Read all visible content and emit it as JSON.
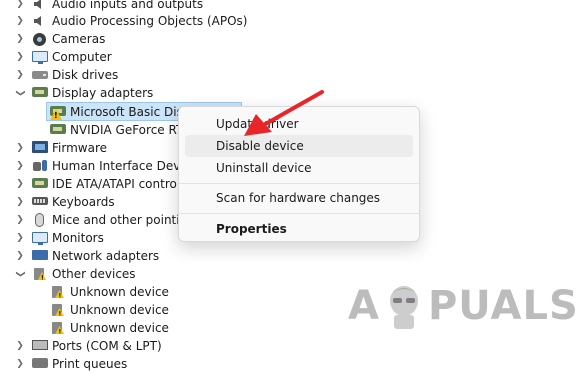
{
  "tree": {
    "items": [
      {
        "label": "Audio inputs and outputs",
        "expanded": false,
        "icon": "speaker-icon"
      },
      {
        "label": "Audio Processing Objects (APOs)",
        "expanded": false,
        "icon": "speaker-icon"
      },
      {
        "label": "Cameras",
        "expanded": false,
        "icon": "camera-icon"
      },
      {
        "label": "Computer",
        "expanded": false,
        "icon": "monitor-icon"
      },
      {
        "label": "Disk drives",
        "expanded": false,
        "icon": "disk-drive-icon"
      },
      {
        "label": "Display adapters",
        "expanded": true,
        "icon": "display-adapter-icon"
      },
      {
        "label": "Microsoft Basic Display Adapter",
        "child": true,
        "selected": true,
        "icon": "warning-adapter-icon"
      },
      {
        "label": "NVIDIA GeForce RTX",
        "child": true,
        "icon": "display-adapter-icon"
      },
      {
        "label": "Firmware",
        "expanded": false,
        "icon": "chip-icon"
      },
      {
        "label": "Human Interface Devices",
        "expanded": false,
        "icon": "hid-icon"
      },
      {
        "label": "IDE ATA/ATAPI controllers",
        "expanded": false,
        "icon": "controller-icon"
      },
      {
        "label": "Keyboards",
        "expanded": false,
        "icon": "keyboard-icon"
      },
      {
        "label": "Mice and other pointing devices",
        "expanded": false,
        "icon": "mouse-icon"
      },
      {
        "label": "Monitors",
        "expanded": false,
        "icon": "monitor-icon"
      },
      {
        "label": "Network adapters",
        "expanded": false,
        "icon": "network-icon"
      },
      {
        "label": "Other devices",
        "expanded": true,
        "icon": "other-devices-icon"
      },
      {
        "label": "Unknown device",
        "child": true,
        "icon": "warning-device-icon"
      },
      {
        "label": "Unknown device",
        "child": true,
        "icon": "warning-device-icon"
      },
      {
        "label": "Unknown device",
        "child": true,
        "icon": "warning-device-icon"
      },
      {
        "label": "Ports (COM & LPT)",
        "expanded": false,
        "icon": "port-icon"
      },
      {
        "label": "Print queues",
        "expanded": false,
        "icon": "printer-icon"
      }
    ]
  },
  "context_menu": {
    "items": [
      {
        "label": "Update driver"
      },
      {
        "label": "Disable device",
        "hover": true
      },
      {
        "label": "Uninstall device"
      },
      {
        "label": "Scan for hardware changes"
      },
      {
        "label": "Properties",
        "bold": true
      }
    ]
  },
  "watermark": {
    "text_left": "A",
    "text_right": "PUALS"
  },
  "colors": {
    "selection": "#cce4f7",
    "arrow": "#e8262a",
    "warning": "#f2c200"
  }
}
